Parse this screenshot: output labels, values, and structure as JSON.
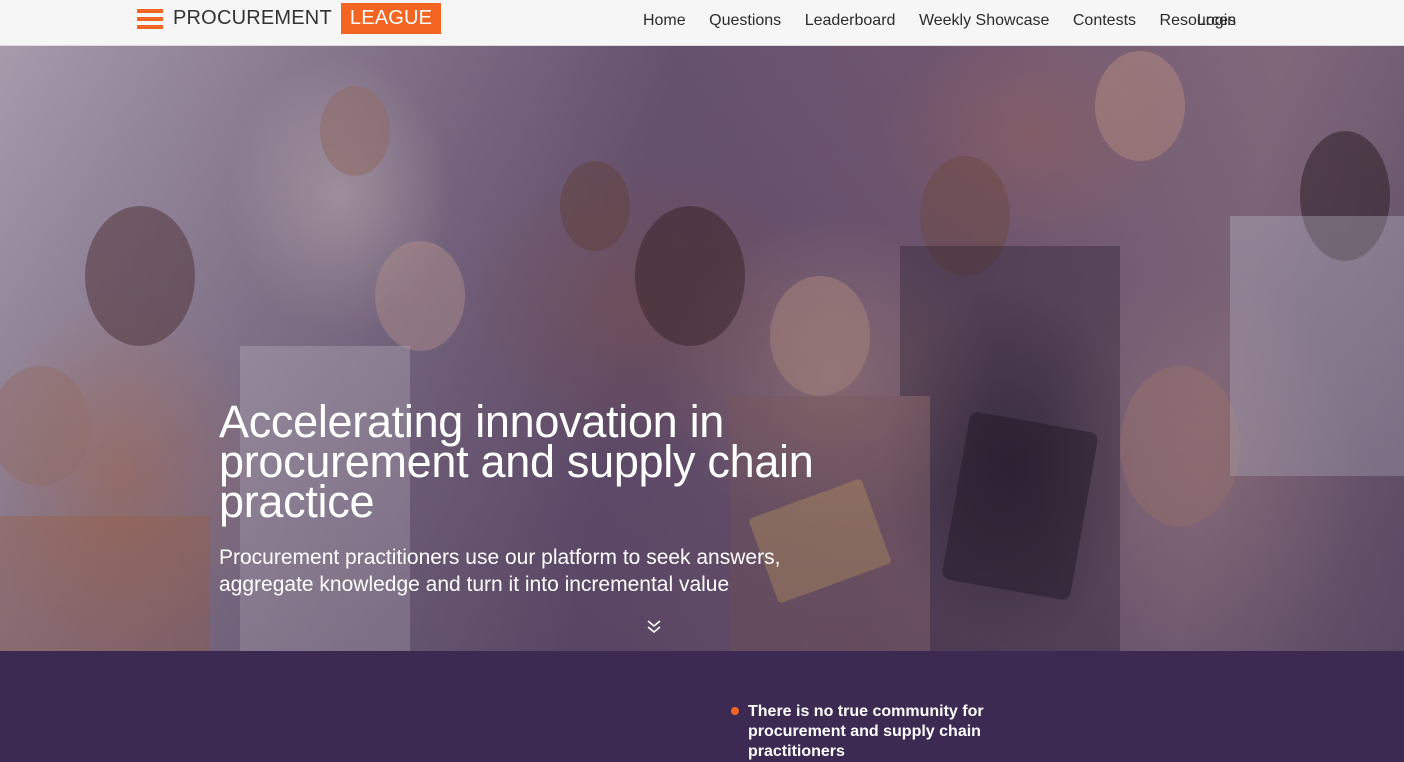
{
  "brand": {
    "name": "PROCUREMENT",
    "accent": "LEAGUE",
    "accent_color": "#f26522"
  },
  "nav": {
    "items": [
      "Home",
      "Questions",
      "Leaderboard",
      "Weekly Showcase",
      "Contests",
      "Resources"
    ],
    "login": "Login"
  },
  "hero": {
    "title": "Accelerating innovation in procurement and supply chain practice",
    "subtitle": "Procurement practitioners use our platform to seek answers, aggregate knowledge and turn it into incremental value",
    "scroll_icon": "double-chevron-down-icon"
  },
  "section": {
    "bullets": [
      "There is no true community for procurement and supply chain practitioners"
    ],
    "background_color": "#3c2a52"
  }
}
